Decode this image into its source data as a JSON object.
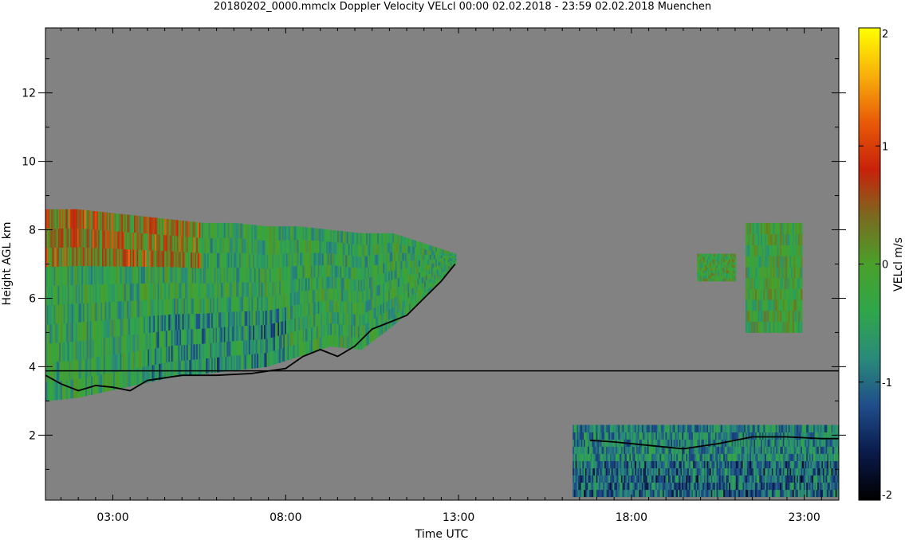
{
  "chart_data": {
    "type": "heatmap",
    "title": "20180202_0000.mmclx Doppler Velocity VELcl   00:00 02.02.2018 - 23:59 02.02.2018 Muenchen",
    "xlabel": "Time UTC",
    "ylabel": "Height AGL km",
    "x_unit": "hours UTC",
    "y_unit": "km",
    "xlim": [
      1.05,
      24.0
    ],
    "ylim": [
      0.1,
      13.9
    ],
    "x_major_ticks": [
      3,
      8,
      13,
      18,
      23
    ],
    "x_tick_labels": [
      "03:00",
      "08:00",
      "13:00",
      "18:00",
      "23:00"
    ],
    "x_minor_ticks": [
      1.5,
      2,
      2.5,
      3.5,
      4,
      4.5,
      5,
      5.5,
      6,
      6.5,
      7,
      7.5,
      8.5,
      9,
      9.5,
      10,
      10.5,
      11,
      11.5,
      12,
      12.5,
      13.5,
      14,
      14.5,
      15,
      15.5,
      16,
      16.5,
      17,
      17.5,
      18.5,
      19,
      19.5,
      20,
      20.5,
      21,
      21.5,
      22,
      22.5,
      23.5
    ],
    "y_major_ticks": [
      2,
      4,
      6,
      8,
      10,
      12
    ],
    "y_tick_labels": [
      "2",
      "4",
      "6",
      "8",
      "10",
      "12"
    ],
    "colorbar": {
      "label": "VELcl m/s",
      "range": [
        -2,
        2
      ],
      "ticks": [
        2,
        1,
        0,
        -1,
        -2
      ],
      "tick_labels": [
        "2",
        "1",
        "0",
        "-1",
        "-2"
      ],
      "colormap": [
        "#000000",
        "#0a1a4a",
        "#1f4d8a",
        "#2a8a7a",
        "#2fa64a",
        "#4aa02a",
        "#7a6a20",
        "#c8220a",
        "#e85a08",
        "#f8b00a",
        "#ffff00"
      ]
    },
    "background_color": "#828282",
    "echo_regions": [
      {
        "name": "upper cloud",
        "t_start": 1.05,
        "t_end": 12.9,
        "bottom_km": [
          3.0,
          3.1,
          3.3,
          3.5,
          3.7,
          3.8,
          3.9,
          4.0,
          4.3,
          4.6,
          4.5,
          5.2,
          6.0,
          7.0
        ],
        "top_km": [
          8.6,
          8.6,
          8.5,
          8.4,
          8.3,
          8.2,
          8.2,
          8.1,
          8.1,
          8.0,
          7.9,
          7.9,
          7.6,
          7.3
        ],
        "mean_velocity_ms": -0.4
      },
      {
        "name": "evening cloud left",
        "t_start": 19.9,
        "t_end": 21.0,
        "bottom_km": 6.5,
        "top_km": 7.3,
        "mean_velocity_ms": -0.2
      },
      {
        "name": "evening cloud right",
        "t_start": 21.3,
        "t_end": 22.9,
        "bottom_km": 5.0,
        "top_km": 8.2,
        "mean_velocity_ms": -0.2
      },
      {
        "name": "boundary layer",
        "t_start": 16.3,
        "t_end": 24.0,
        "bottom_km": 0.2,
        "top_km": 2.3,
        "mean_velocity_ms": -0.8
      }
    ],
    "reference_line_km": 3.88,
    "cloud_base_trace": {
      "t": [
        1.05,
        1.5,
        2.0,
        2.5,
        3.0,
        3.5,
        4.0,
        5.0,
        6.0,
        7.0,
        8.0,
        8.5,
        9.0,
        9.5,
        10.0,
        10.5,
        11.0,
        11.5,
        12.0,
        12.5,
        12.9
      ],
      "h_km": [
        3.75,
        3.5,
        3.3,
        3.45,
        3.4,
        3.3,
        3.6,
        3.75,
        3.75,
        3.8,
        3.95,
        4.3,
        4.5,
        4.3,
        4.6,
        5.1,
        5.3,
        5.5,
        6.0,
        6.5,
        7.0
      ]
    },
    "bl_top_trace": {
      "t": [
        16.8,
        17.5,
        18.5,
        19.5,
        20.5,
        21.5,
        22.5,
        23.5,
        24.0
      ],
      "h_km": [
        1.85,
        1.8,
        1.7,
        1.6,
        1.75,
        1.95,
        1.95,
        1.9,
        1.9
      ]
    }
  }
}
